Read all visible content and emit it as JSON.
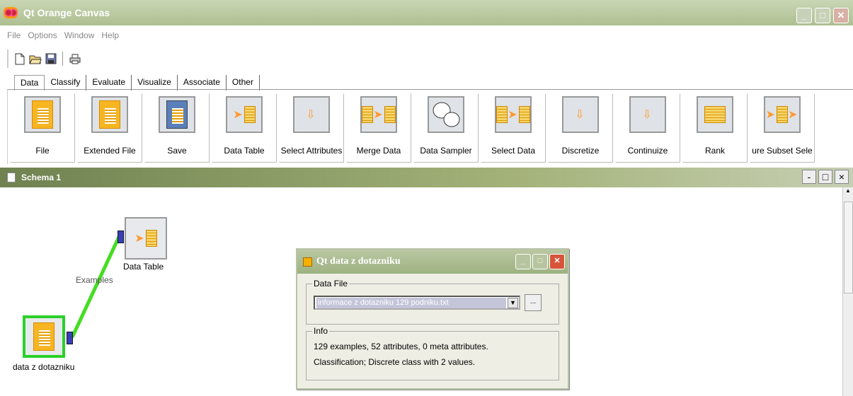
{
  "app": {
    "title": "Qt Orange Canvas"
  },
  "menu": [
    "File",
    "Options",
    "Window",
    "Help"
  ],
  "tabs": [
    "Data",
    "Classify",
    "Evaluate",
    "Visualize",
    "Associate",
    "Other"
  ],
  "widgets": [
    "File",
    "Extended File",
    "Save",
    "Data Table",
    "Select Attributes",
    "Merge Data",
    "Data Sampler",
    "Select Data",
    "Discretize",
    "Continuize",
    "Rank",
    "ure Subset Sele"
  ],
  "schema": {
    "title": "Schema 1"
  },
  "canvas": {
    "node_file_label": "data z dotazniku",
    "node_table_label": "Data Table",
    "link_label": "Examples"
  },
  "dialog": {
    "title": "Qt data z dotazniku",
    "datafile_legend": "Data File",
    "file_value": "informace z dotazniku 129 podniku.txt",
    "browse_label": "...",
    "info_legend": "Info",
    "info_line1": "129 examples, 52 attributes, 0 meta attributes.",
    "info_line2": "Classification; Discrete class with 2 values."
  },
  "colors": {
    "selection": "#2bd02b",
    "link": "#44dd22",
    "port": "#3a3fb3"
  }
}
